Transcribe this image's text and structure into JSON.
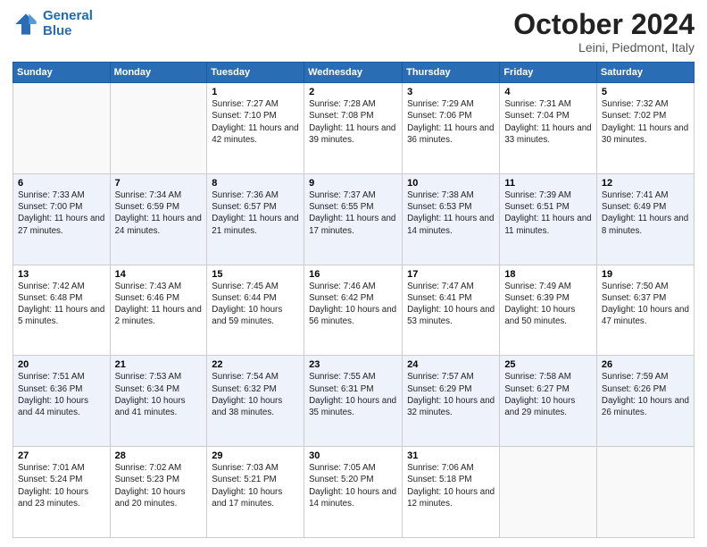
{
  "header": {
    "logo_line1": "General",
    "logo_line2": "Blue",
    "month": "October 2024",
    "location": "Leini, Piedmont, Italy"
  },
  "weekdays": [
    "Sunday",
    "Monday",
    "Tuesday",
    "Wednesday",
    "Thursday",
    "Friday",
    "Saturday"
  ],
  "weeks": [
    [
      {
        "day": "",
        "info": ""
      },
      {
        "day": "",
        "info": ""
      },
      {
        "day": "1",
        "info": "Sunrise: 7:27 AM\nSunset: 7:10 PM\nDaylight: 11 hours and 42 minutes."
      },
      {
        "day": "2",
        "info": "Sunrise: 7:28 AM\nSunset: 7:08 PM\nDaylight: 11 hours and 39 minutes."
      },
      {
        "day": "3",
        "info": "Sunrise: 7:29 AM\nSunset: 7:06 PM\nDaylight: 11 hours and 36 minutes."
      },
      {
        "day": "4",
        "info": "Sunrise: 7:31 AM\nSunset: 7:04 PM\nDaylight: 11 hours and 33 minutes."
      },
      {
        "day": "5",
        "info": "Sunrise: 7:32 AM\nSunset: 7:02 PM\nDaylight: 11 hours and 30 minutes."
      }
    ],
    [
      {
        "day": "6",
        "info": "Sunrise: 7:33 AM\nSunset: 7:00 PM\nDaylight: 11 hours and 27 minutes."
      },
      {
        "day": "7",
        "info": "Sunrise: 7:34 AM\nSunset: 6:59 PM\nDaylight: 11 hours and 24 minutes."
      },
      {
        "day": "8",
        "info": "Sunrise: 7:36 AM\nSunset: 6:57 PM\nDaylight: 11 hours and 21 minutes."
      },
      {
        "day": "9",
        "info": "Sunrise: 7:37 AM\nSunset: 6:55 PM\nDaylight: 11 hours and 17 minutes."
      },
      {
        "day": "10",
        "info": "Sunrise: 7:38 AM\nSunset: 6:53 PM\nDaylight: 11 hours and 14 minutes."
      },
      {
        "day": "11",
        "info": "Sunrise: 7:39 AM\nSunset: 6:51 PM\nDaylight: 11 hours and 11 minutes."
      },
      {
        "day": "12",
        "info": "Sunrise: 7:41 AM\nSunset: 6:49 PM\nDaylight: 11 hours and 8 minutes."
      }
    ],
    [
      {
        "day": "13",
        "info": "Sunrise: 7:42 AM\nSunset: 6:48 PM\nDaylight: 11 hours and 5 minutes."
      },
      {
        "day": "14",
        "info": "Sunrise: 7:43 AM\nSunset: 6:46 PM\nDaylight: 11 hours and 2 minutes."
      },
      {
        "day": "15",
        "info": "Sunrise: 7:45 AM\nSunset: 6:44 PM\nDaylight: 10 hours and 59 minutes."
      },
      {
        "day": "16",
        "info": "Sunrise: 7:46 AM\nSunset: 6:42 PM\nDaylight: 10 hours and 56 minutes."
      },
      {
        "day": "17",
        "info": "Sunrise: 7:47 AM\nSunset: 6:41 PM\nDaylight: 10 hours and 53 minutes."
      },
      {
        "day": "18",
        "info": "Sunrise: 7:49 AM\nSunset: 6:39 PM\nDaylight: 10 hours and 50 minutes."
      },
      {
        "day": "19",
        "info": "Sunrise: 7:50 AM\nSunset: 6:37 PM\nDaylight: 10 hours and 47 minutes."
      }
    ],
    [
      {
        "day": "20",
        "info": "Sunrise: 7:51 AM\nSunset: 6:36 PM\nDaylight: 10 hours and 44 minutes."
      },
      {
        "day": "21",
        "info": "Sunrise: 7:53 AM\nSunset: 6:34 PM\nDaylight: 10 hours and 41 minutes."
      },
      {
        "day": "22",
        "info": "Sunrise: 7:54 AM\nSunset: 6:32 PM\nDaylight: 10 hours and 38 minutes."
      },
      {
        "day": "23",
        "info": "Sunrise: 7:55 AM\nSunset: 6:31 PM\nDaylight: 10 hours and 35 minutes."
      },
      {
        "day": "24",
        "info": "Sunrise: 7:57 AM\nSunset: 6:29 PM\nDaylight: 10 hours and 32 minutes."
      },
      {
        "day": "25",
        "info": "Sunrise: 7:58 AM\nSunset: 6:27 PM\nDaylight: 10 hours and 29 minutes."
      },
      {
        "day": "26",
        "info": "Sunrise: 7:59 AM\nSunset: 6:26 PM\nDaylight: 10 hours and 26 minutes."
      }
    ],
    [
      {
        "day": "27",
        "info": "Sunrise: 7:01 AM\nSunset: 5:24 PM\nDaylight: 10 hours and 23 minutes."
      },
      {
        "day": "28",
        "info": "Sunrise: 7:02 AM\nSunset: 5:23 PM\nDaylight: 10 hours and 20 minutes."
      },
      {
        "day": "29",
        "info": "Sunrise: 7:03 AM\nSunset: 5:21 PM\nDaylight: 10 hours and 17 minutes."
      },
      {
        "day": "30",
        "info": "Sunrise: 7:05 AM\nSunset: 5:20 PM\nDaylight: 10 hours and 14 minutes."
      },
      {
        "day": "31",
        "info": "Sunrise: 7:06 AM\nSunset: 5:18 PM\nDaylight: 10 hours and 12 minutes."
      },
      {
        "day": "",
        "info": ""
      },
      {
        "day": "",
        "info": ""
      }
    ]
  ]
}
